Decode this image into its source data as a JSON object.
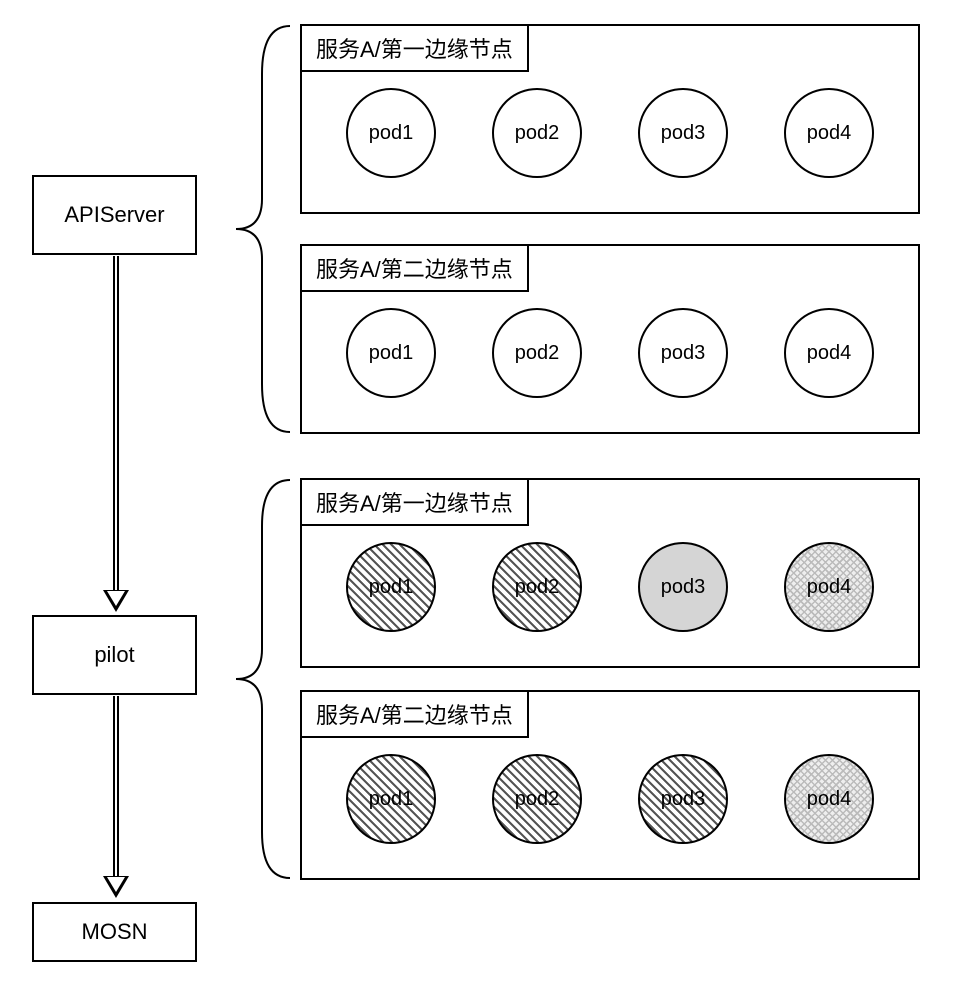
{
  "components": {
    "apiserver": "APIServer",
    "pilot": "pilot",
    "mosn": "MOSN"
  },
  "groups": {
    "g1": {
      "title": "服务A/第一边缘节点",
      "pods": [
        "pod1",
        "pod2",
        "pod3",
        "pod4"
      ],
      "styles": [
        "plain",
        "plain",
        "plain",
        "plain"
      ]
    },
    "g2": {
      "title": "服务A/第二边缘节点",
      "pods": [
        "pod1",
        "pod2",
        "pod3",
        "pod4"
      ],
      "styles": [
        "plain",
        "plain",
        "plain",
        "plain"
      ]
    },
    "g3": {
      "title": "服务A/第一边缘节点",
      "pods": [
        "pod1",
        "pod2",
        "pod3",
        "pod4"
      ],
      "styles": [
        "hatch",
        "hatch",
        "gray",
        "cross"
      ]
    },
    "g4": {
      "title": "服务A/第二边缘节点",
      "pods": [
        "pod1",
        "pod2",
        "pod3",
        "pod4"
      ],
      "styles": [
        "hatch",
        "hatch",
        "hatch",
        "cross"
      ]
    }
  }
}
